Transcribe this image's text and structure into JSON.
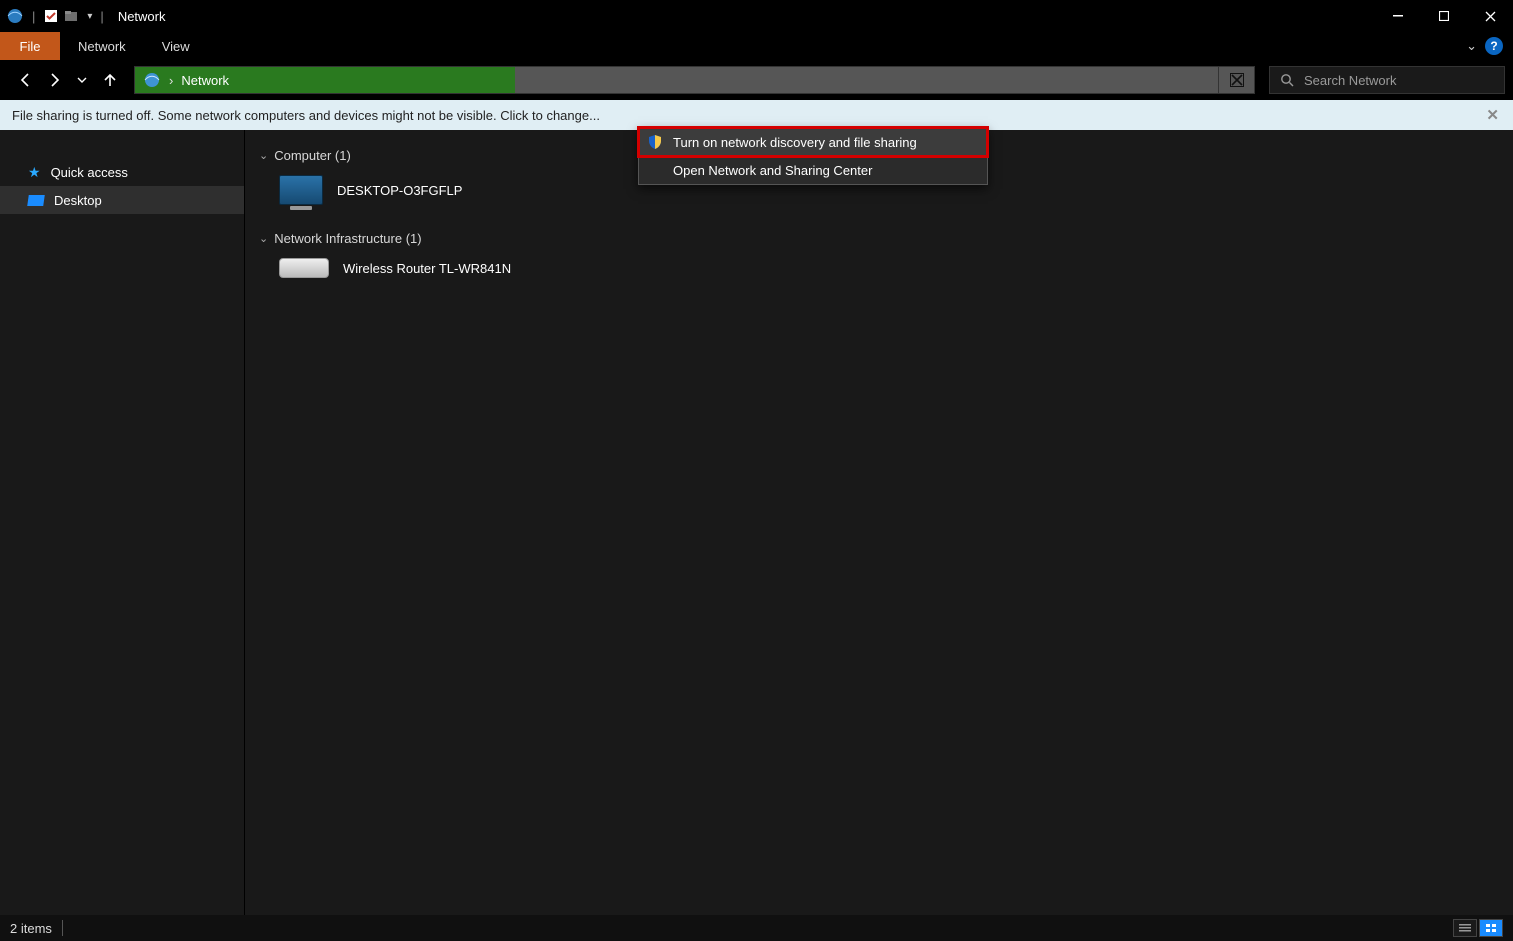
{
  "titlebar": {
    "title": "Network"
  },
  "ribbon": {
    "file_label": "File",
    "tabs": [
      "Network",
      "View"
    ]
  },
  "nav": {
    "breadcrumb_sep": "›",
    "breadcrumb_label": "Network"
  },
  "search": {
    "placeholder": "Search Network"
  },
  "notify": {
    "message": "File sharing is turned off. Some network computers and devices might not be visible. Click to change..."
  },
  "contextMenu": {
    "items": [
      "Turn on network discovery and file sharing",
      "Open Network and Sharing Center"
    ]
  },
  "sidebar": {
    "items": [
      {
        "label": "Quick access"
      },
      {
        "label": "Desktop"
      }
    ]
  },
  "content": {
    "groups": [
      {
        "title": "Computer (1)",
        "items": [
          {
            "label": "DESKTOP-O3FGFLP"
          }
        ]
      },
      {
        "title": "Network Infrastructure (1)",
        "items": [
          {
            "label": "Wireless Router TL-WR841N"
          }
        ]
      }
    ]
  },
  "status": {
    "count_label": "2 items"
  }
}
